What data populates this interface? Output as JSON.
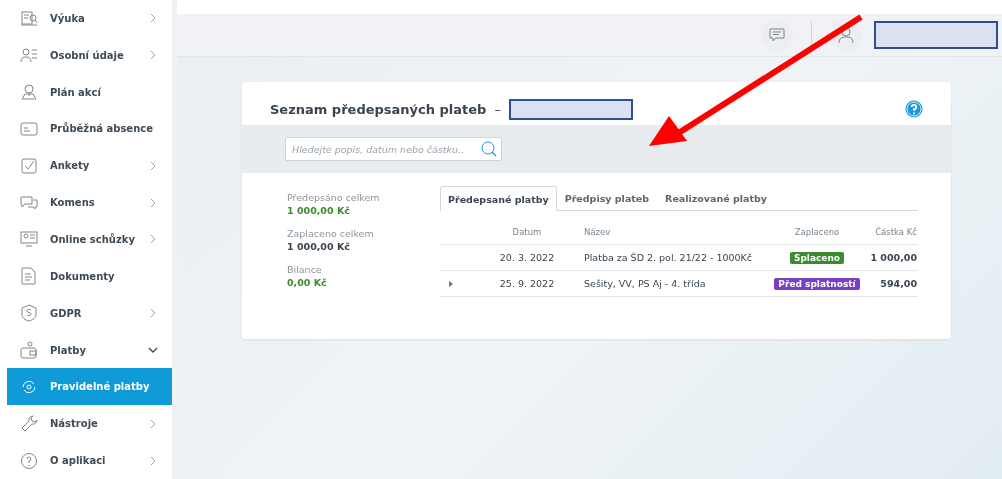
{
  "sidebar": {
    "items": [
      {
        "label": "Výuka",
        "kind": "submenu",
        "expanded": false,
        "selected": false
      },
      {
        "label": "Osobní údaje",
        "kind": "submenu",
        "expanded": false,
        "selected": false
      },
      {
        "label": "Plán akcí",
        "kind": "link",
        "selected": false
      },
      {
        "label": "Průběžná absence",
        "kind": "link",
        "selected": false
      },
      {
        "label": "Ankety",
        "kind": "submenu",
        "expanded": false,
        "selected": false
      },
      {
        "label": "Komens",
        "kind": "submenu",
        "expanded": false,
        "selected": false
      },
      {
        "label": "Online schůzky",
        "kind": "submenu",
        "expanded": false,
        "selected": false
      },
      {
        "label": "Dokumenty",
        "kind": "link",
        "selected": false
      },
      {
        "label": "GDPR",
        "kind": "submenu",
        "expanded": false,
        "selected": false
      },
      {
        "label": "Platby",
        "kind": "submenu",
        "expanded": true,
        "selected": false
      },
      {
        "label": "Pravidelné platby",
        "kind": "link",
        "selected": true
      },
      {
        "label": "Nástroje",
        "kind": "submenu",
        "expanded": false,
        "selected": false
      },
      {
        "label": "O aplikaci",
        "kind": "submenu",
        "expanded": false,
        "selected": false
      }
    ]
  },
  "card": {
    "title": "Seznam předepsaných plateb",
    "separator": "–",
    "search": {
      "placeholder": "Hledejte popis, datum nebo částku.."
    },
    "summary": [
      {
        "label": "Předepsáno celkem",
        "value": "1 000,00 Kč",
        "positive": true
      },
      {
        "label": "Zaplaceno celkem",
        "value": "1 000,00 Kč",
        "positive": false
      },
      {
        "label": "Bilance",
        "value": "0,00 Kč",
        "positive": true
      }
    ],
    "tabs": [
      {
        "label": "Předepsané platby",
        "selected": true
      },
      {
        "label": "Předpisy plateb",
        "selected": false
      },
      {
        "label": "Realizované platby",
        "selected": false
      }
    ],
    "table": {
      "columns": [
        "Datum",
        "Název",
        "Zaplaceno",
        "Částka Kč"
      ],
      "rows": [
        {
          "expandable": false,
          "date": "20. 3. 2022",
          "name": "Platba za ŠD 2. pol. 21/22 - 1000Kč",
          "status": "Splaceno",
          "color": "#3d8b2f",
          "amount": "1 000,00"
        },
        {
          "expandable": true,
          "date": "25. 9. 2022",
          "name": "Sešity, VV, PS Aj - 4. třída",
          "status": "Před splatností",
          "color": "#7a3fc6",
          "amount": "594,00"
        }
      ]
    }
  }
}
